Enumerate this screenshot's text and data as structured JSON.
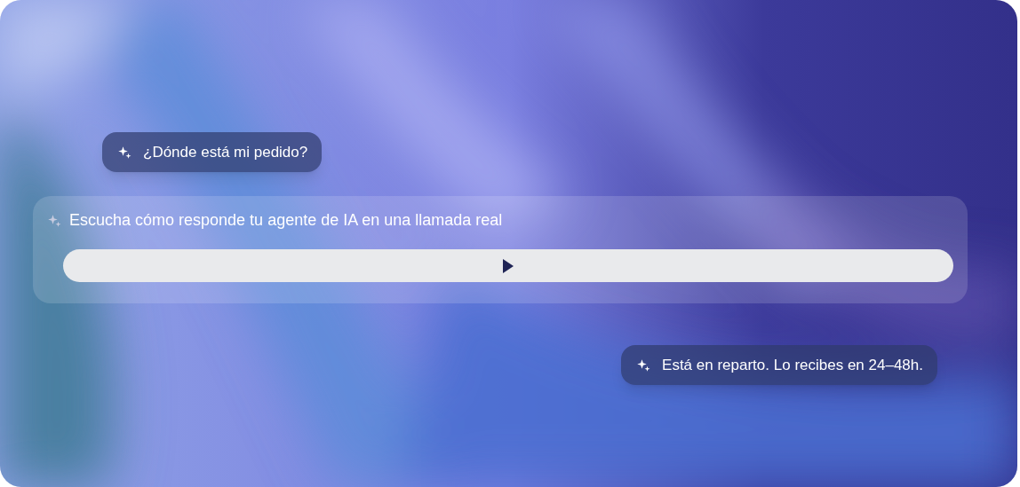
{
  "question": {
    "text": "¿Dónde está mi pedido?"
  },
  "player_card": {
    "title": "Escucha cómo responde tu agente de IA en una llamada real",
    "player": {
      "playing": false
    }
  },
  "answer": {
    "text": "Está en reparto. Lo recibes en 24–48h."
  }
}
